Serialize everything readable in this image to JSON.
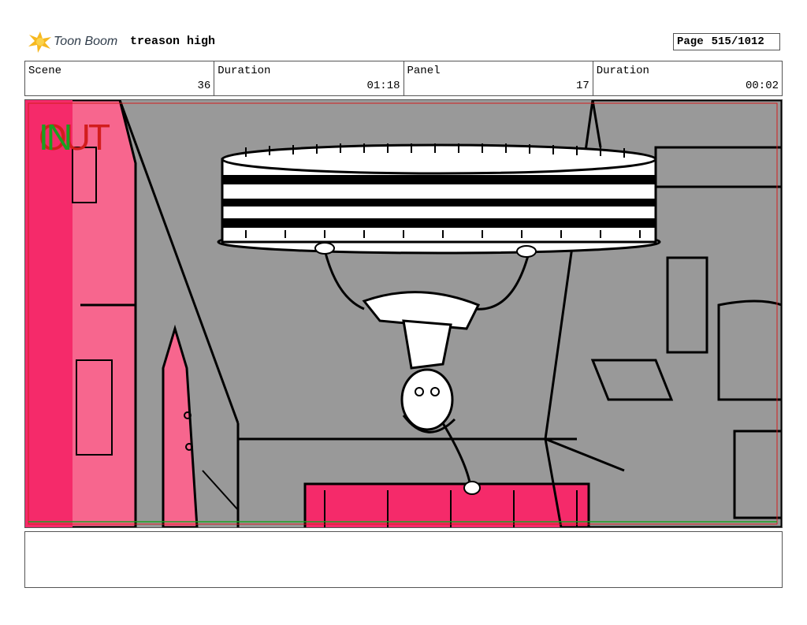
{
  "header": {
    "logo_text": "Toon Boom",
    "project_title": "treason high",
    "page_label": "Page",
    "page_value": "515/1012"
  },
  "info": {
    "scene_label": "Scene",
    "scene_value": "36",
    "scene_duration_label": "Duration",
    "scene_duration_value": "01:18",
    "panel_label": "Panel",
    "panel_value": "17",
    "panel_duration_label": "Duration",
    "panel_duration_value": "00:02"
  },
  "panel": {
    "in_marker": "IN",
    "out_marker": "OUT",
    "colors": {
      "background_gray": "#999999",
      "pink_wall": "#f7668e",
      "hot_pink": "#f52a6a",
      "line": "#000000",
      "in_green": "#1aa020",
      "out_red": "#d21d1d"
    }
  },
  "notes": {
    "text": ""
  }
}
